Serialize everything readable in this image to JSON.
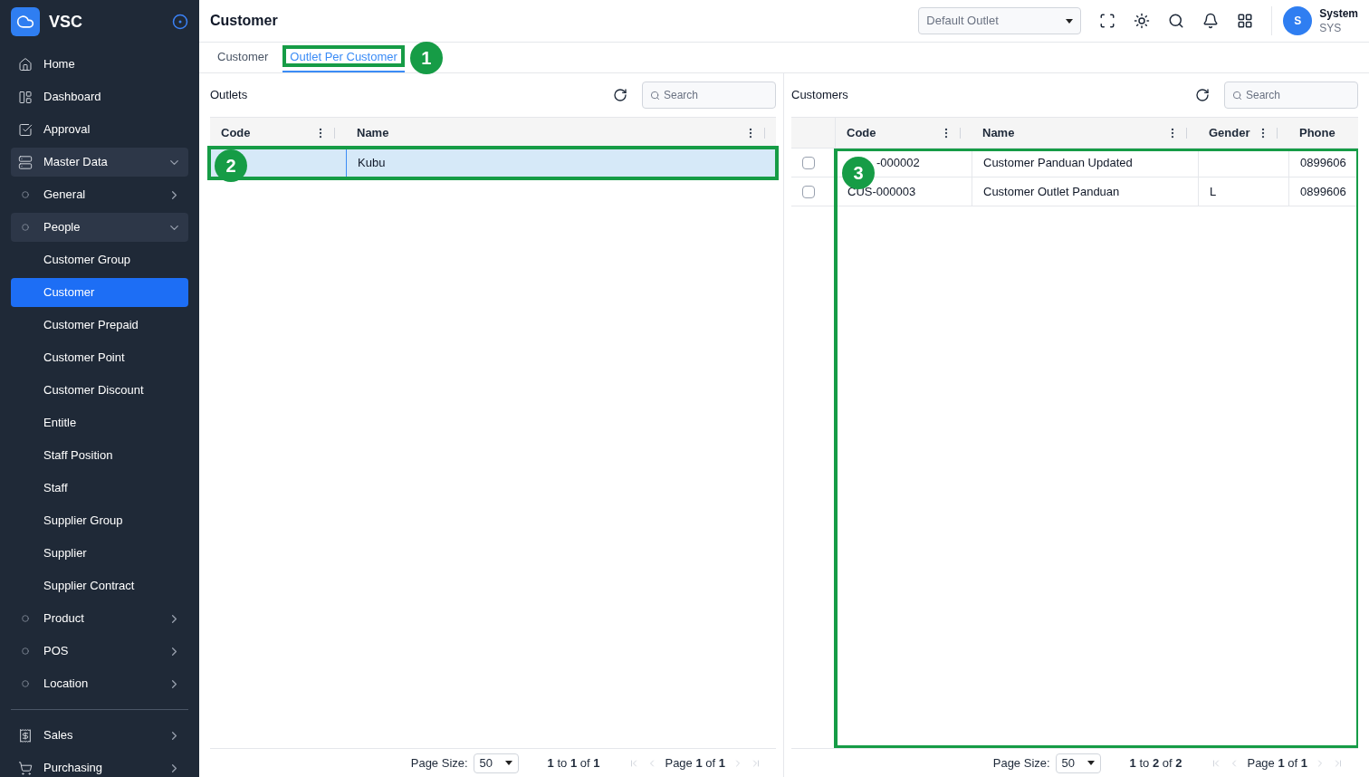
{
  "sidebar": {
    "brand": "VSC",
    "items": [
      {
        "label": "Home",
        "kind": "link",
        "selected": false
      },
      {
        "label": "Dashboard",
        "kind": "link",
        "selected": false
      },
      {
        "label": "Approval",
        "kind": "link",
        "selected": false
      },
      {
        "label": "Master Data",
        "kind": "group",
        "expanded": true,
        "selected": false,
        "children": [
          {
            "label": "General",
            "kind": "group",
            "expanded": false,
            "selected": false
          },
          {
            "label": "People",
            "kind": "group",
            "expanded": true,
            "selected": false,
            "children": [
              {
                "label": "Customer Group",
                "kind": "link",
                "selected": false
              },
              {
                "label": "Customer",
                "kind": "link",
                "selected": true
              },
              {
                "label": "Customer Prepaid",
                "kind": "link",
                "selected": false
              },
              {
                "label": "Customer Point",
                "kind": "link",
                "selected": false
              },
              {
                "label": "Customer Discount",
                "kind": "link",
                "selected": false
              },
              {
                "label": "Entitle",
                "kind": "link",
                "selected": false
              },
              {
                "label": "Staff Position",
                "kind": "link",
                "selected": false
              },
              {
                "label": "Staff",
                "kind": "link",
                "selected": false
              },
              {
                "label": "Supplier Group",
                "kind": "link",
                "selected": false
              },
              {
                "label": "Supplier",
                "kind": "link",
                "selected": false
              },
              {
                "label": "Supplier Contract",
                "kind": "link",
                "selected": false
              }
            ]
          },
          {
            "label": "Product",
            "kind": "group",
            "expanded": false,
            "selected": false
          },
          {
            "label": "POS",
            "kind": "group",
            "expanded": false,
            "selected": false
          },
          {
            "label": "Location",
            "kind": "group",
            "expanded": false,
            "selected": false
          }
        ]
      }
    ],
    "bottom_items": [
      {
        "label": "Sales",
        "kind": "group",
        "expanded": false,
        "selected": false
      },
      {
        "label": "Purchasing",
        "kind": "group",
        "expanded": false,
        "selected": false
      }
    ]
  },
  "header": {
    "title": "Customer",
    "outlet_select": {
      "placeholder": "Default Outlet"
    },
    "user": {
      "initial": "S",
      "name": "System",
      "code": "SYS"
    }
  },
  "tabs": [
    {
      "label": "Customer",
      "selected": false
    },
    {
      "label": "Outlet Per Customer",
      "selected": true
    }
  ],
  "outlets": {
    "title": "Outlets",
    "search": {
      "placeholder": "Search"
    },
    "columns": [
      "Code",
      "Name"
    ],
    "rows": [
      {
        "name": "Kubu",
        "selected": true
      }
    ],
    "footer": {
      "page_size_label": "Page Size:",
      "page_size": "50",
      "range": "**1** to **1** of **1**",
      "page": "Page **1** of **1**"
    }
  },
  "customers": {
    "title": "Customers",
    "search": {
      "placeholder": "Search"
    },
    "columns": [
      "Code",
      "Name",
      "Gender",
      "Phone"
    ],
    "rows": [
      {
        "code": "-000002",
        "name": "Customer Panduan Updated",
        "phone": "0899606",
        "checked": false
      },
      {
        "code": "CUS-000003",
        "name": "Customer Outlet Panduan",
        "gender": "L",
        "phone": "0899606",
        "checked": false
      }
    ],
    "footer": {
      "page_size_label": "Page Size:",
      "page_size": "50",
      "range": "**1** to **2** of **2**",
      "page": "Page **1** of **1**"
    }
  },
  "annotations": [
    {
      "label": "1"
    },
    {
      "label": "2"
    },
    {
      "label": "3"
    }
  ]
}
